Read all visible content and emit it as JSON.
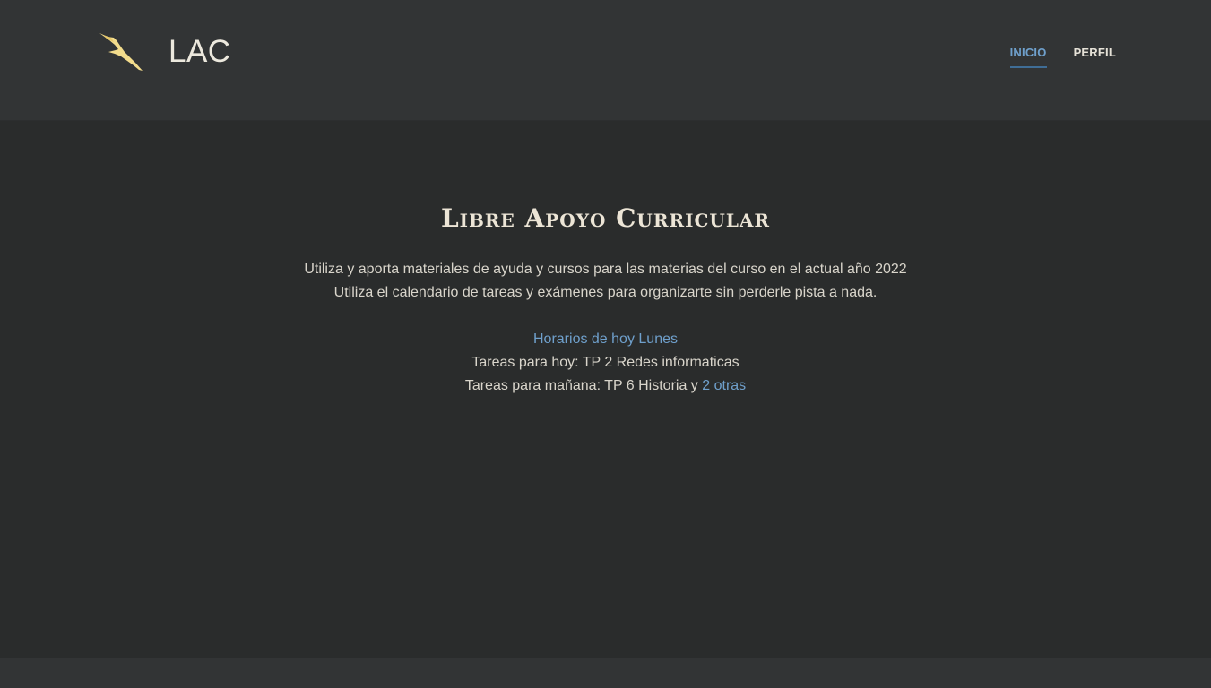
{
  "header": {
    "brand": "LAC",
    "logo_icon": "bird-icon",
    "logo_color": "#f3dc8c",
    "nav": [
      {
        "label": "INICIO",
        "active": true
      },
      {
        "label": "PERFIL",
        "active": false
      }
    ]
  },
  "main": {
    "title": "Libre Apoyo Curricular",
    "description_line1": "Utiliza y aporta materiales de ayuda y cursos para las materias del curso en el actual año 2022",
    "description_line2": "Utiliza el calendario de tareas y exámenes para organizarte sin perderle pista a nada.",
    "schedule_link": "Horarios de hoy Lunes",
    "tasks_today": "Tareas para hoy: TP 2 Redes informaticas",
    "tasks_tomorrow_prefix": "Tareas para mañana: TP 6 Historia y ",
    "tasks_tomorrow_link": "2 otras"
  },
  "colors": {
    "background": "#2a2c2c",
    "header_bg": "#323435",
    "accent": "#6fa0cc",
    "text": "#d9d5cb"
  }
}
